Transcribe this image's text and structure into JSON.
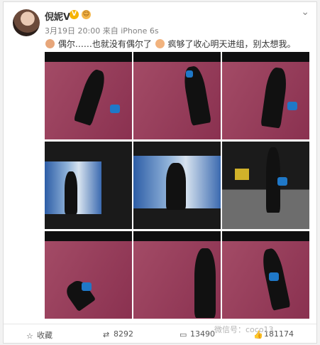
{
  "post": {
    "username": "倪妮V",
    "time": "3月19日 20:00",
    "source_prefix": "来自",
    "source": "iPhone 6s",
    "text_part1": "偶尔……也就没有偶尔了",
    "text_part2": "疯够了收心明天进组，别太想我。"
  },
  "footer": {
    "favorite_label": "收藏",
    "repost_count": "8292",
    "comment_count": "13490",
    "like_count": "181174"
  },
  "watermark": "微信号：coco13",
  "colors": {
    "accent_pink": "#9b3e5a",
    "bag_blue": "#1f78c8",
    "badge_gold": "#f6b400"
  },
  "icons": [
    "chevron-down-icon",
    "star-icon",
    "repost-icon",
    "comment-icon",
    "like-icon"
  ]
}
